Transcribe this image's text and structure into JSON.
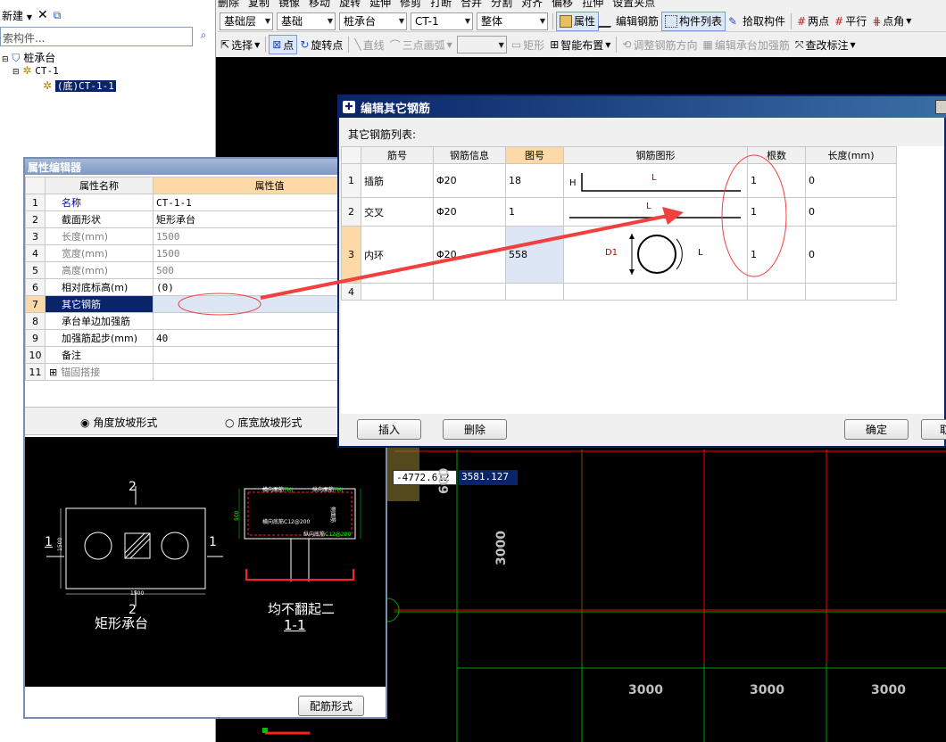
{
  "toolbar_top": {
    "items": [
      "新建",
      "删除",
      "复制",
      "镜像",
      "移动",
      "旋转",
      "延伸",
      "修剪",
      "打断",
      "合并",
      "分割",
      "对齐",
      "偏移",
      "拉伸",
      "设置夹点"
    ],
    "floor_combo": "基础层",
    "category_combo": "基础",
    "type_combo": "桩承台",
    "name_combo": "CT-1",
    "whole_combo": "整体",
    "property_btn": "属性",
    "edit_rebar_btn": "编辑钢筋",
    "component_list_btn": "构件列表",
    "pick_component_btn": "拾取构件",
    "two_point_btn": "两点",
    "parallel_btn": "平行",
    "angle_btn": "点角"
  },
  "toolbar_draw": {
    "select_btn": "选择",
    "point_btn": "点",
    "rotate_point_btn": "旋转点",
    "line_btn": "直线",
    "arc_btn": "三点画弧",
    "rect_btn": "矩形",
    "smart_btn": "智能布置",
    "adjust_dir_btn": "调整钢筋方向",
    "edit_cap_btn": "编辑承台加强筋",
    "check_mark_btn": "查改标注"
  },
  "left_panel": {
    "new_btn": "新建",
    "search_placeholder": "索构件...",
    "tree": {
      "root": "桩承台",
      "child": "CT-1",
      "leaf": "(底)CT-1-1"
    }
  },
  "prop_editor": {
    "title": "属性编辑器",
    "header_name": "属性名称",
    "header_value": "属性值",
    "rows": [
      {
        "num": "1",
        "name": "名称",
        "value": "CT-1-1"
      },
      {
        "num": "2",
        "name": "截面形状",
        "value": "矩形承台"
      },
      {
        "num": "3",
        "name": "长度(mm)",
        "value": "1500"
      },
      {
        "num": "4",
        "name": "宽度(mm)",
        "value": "1500"
      },
      {
        "num": "5",
        "name": "高度(mm)",
        "value": "500"
      },
      {
        "num": "6",
        "name": "相对底标高(m)",
        "value": "(0)"
      },
      {
        "num": "7",
        "name": "其它钢筋",
        "value": ""
      },
      {
        "num": "8",
        "name": "承台单边加强筋",
        "value": ""
      },
      {
        "num": "9",
        "name": "加强筋起步(mm)",
        "value": "40"
      },
      {
        "num": "10",
        "name": "备注",
        "value": ""
      },
      {
        "num": "11",
        "name": "锚固搭接",
        "value": ""
      }
    ],
    "radio_angle": "角度放坡形式",
    "radio_bottom": "底宽放坡形式",
    "rebar_form_btn": "配筋形式"
  },
  "preview": {
    "sec_no": "2",
    "sec_side": "1",
    "dim_width": "1500",
    "dim_height": "1500",
    "caption_plan": "矩形承台",
    "caption_section_1": "均不翻起二",
    "caption_section_2": "1-1",
    "label_top1": "横向面筋",
    "label_top1_val": "TMJ",
    "label_top2": "纵向面筋",
    "label_top2_val": "TMJ",
    "label_bot1": "横向底筋",
    "label_bot1_val": "C12@200",
    "label_bot2": "纵向底筋",
    "label_bot2_val": "C12@200",
    "label_side": "侧面筋",
    "dim_h": "500"
  },
  "dialog": {
    "title": "编辑其它钢筋",
    "list_label": "其它钢筋列表:",
    "headers": [
      "筋号",
      "钢筋信息",
      "图号",
      "钢筋图形",
      "根数",
      "长度(mm)"
    ],
    "rows": [
      {
        "num": "1",
        "name": "插筋",
        "info": "Φ20",
        "fig": "18",
        "count": "1",
        "length": "0"
      },
      {
        "num": "2",
        "name": "交叉",
        "info": "Φ20",
        "fig": "1",
        "count": "1",
        "length": "0"
      },
      {
        "num": "3",
        "name": "内环",
        "info": "Φ20",
        "fig": "558",
        "count": "1",
        "length": "0"
      },
      {
        "num": "4",
        "name": "",
        "info": "",
        "fig": "",
        "count": "",
        "length": ""
      }
    ],
    "shape_labels": {
      "h": "H",
      "l": "L",
      "d1": "D1"
    },
    "insert_btn": "插入",
    "delete_btn": "删除",
    "ok_btn": "确定",
    "cancel_btn": "取"
  },
  "canvas": {
    "coord_x": "-4772.612",
    "coord_y": "3581.127",
    "dim_600": "600",
    "dim_vertical": "3000",
    "dims_bottom": [
      "3000",
      "3000",
      "3000"
    ]
  },
  "colors": {
    "title_bar": "#0a246a",
    "canvas_bg": "#000000",
    "grid_red": "#ff0000",
    "grid_green": "#00a000",
    "arrow": "#f04040",
    "highlight_yellow": "#fcd9a6"
  }
}
